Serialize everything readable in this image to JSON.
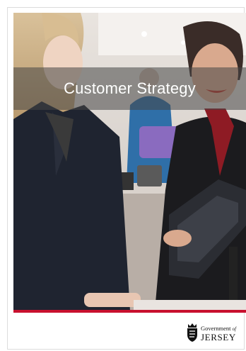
{
  "cover": {
    "title": "Customer Strategy",
    "accent_color": "#c8102e"
  },
  "logo": {
    "line1_main": "Government",
    "line1_of": "of",
    "line2": "JERSEY",
    "icon": "crest-icon"
  }
}
